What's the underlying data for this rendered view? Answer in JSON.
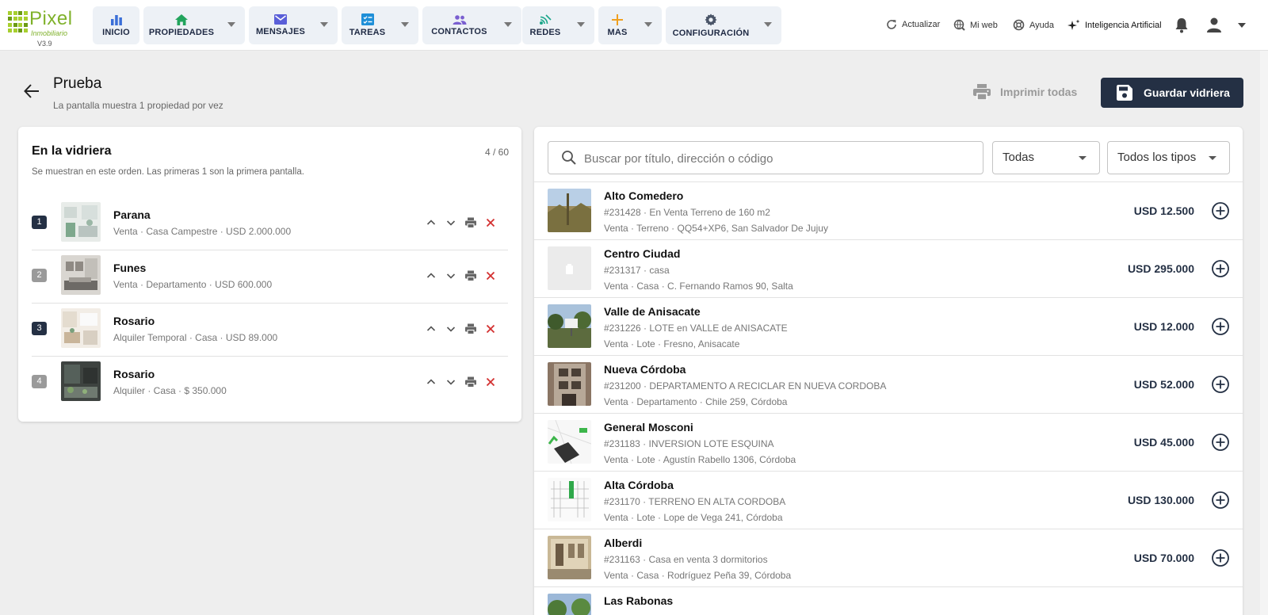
{
  "app": {
    "logo_text": "Pixel",
    "logo_sub": "Inmobiliario",
    "version": "V3.9"
  },
  "nav": {
    "items": [
      {
        "label": "INICIO",
        "icon": "bar-chart-icon",
        "color": "#3b6fd8"
      },
      {
        "label": "PROPIEDADES",
        "icon": "home-icon",
        "color": "#22a45d"
      },
      {
        "label": "MENSAJES",
        "icon": "mail-icon",
        "color": "#5a5fd8"
      },
      {
        "label": "TAREAS",
        "icon": "tasks-icon",
        "color": "#1f8fd8"
      },
      {
        "label": "CONTACTOS",
        "icon": "people-icon",
        "color": "#7a5fd0"
      },
      {
        "label": "REDES",
        "icon": "network-icon",
        "color": "#1aa68a"
      },
      {
        "label": "MAS",
        "icon": "plus-icon",
        "color": "#f0a020"
      },
      {
        "label": "CONFIGURACIÓN",
        "icon": "gear-icon",
        "color": "#4a5568"
      }
    ]
  },
  "tools": {
    "refresh": "Actualizar",
    "web": "Mi web",
    "help": "Ayuda",
    "ai": "Inteligencia Artificial"
  },
  "header": {
    "title": "Prueba",
    "subtitle": "La pantalla muestra 1 propiedad por vez",
    "print_all": "Imprimir todas",
    "save": "Guardar vidriera"
  },
  "showcase": {
    "title": "En la vidriera",
    "count": "4 / 60",
    "subtitle": "Se muestran en este orden. Las primeras 1 son la primera pantalla.",
    "items": [
      {
        "num": "1",
        "name": "Parana",
        "desc": "Venta · Casa Campestre · USD 2.000.000"
      },
      {
        "num": "2",
        "name": "Funes",
        "desc": "Venta · Departamento · USD 600.000"
      },
      {
        "num": "3",
        "name": "Rosario",
        "desc": "Alquiler Temporal · Casa · USD 89.000"
      },
      {
        "num": "4",
        "name": "Rosario",
        "desc": "Alquiler · Casa · $ 350.000"
      }
    ]
  },
  "catalog": {
    "search_placeholder": "Buscar por título, dirección o código",
    "filter_op": "Todas",
    "filter_type": "Todos los tipos",
    "items": [
      {
        "name": "Alto Comedero",
        "line1": "#231428 · En Venta Terreno de 160 m2",
        "line2": "Venta · Terreno · QQ54+XP6, San Salvador De Jujuy",
        "price": "USD 12.500"
      },
      {
        "name": "Centro Ciudad",
        "line1": "#231317 · casa",
        "line2": "Venta · Casa · C. Fernando Ramos 90, Salta",
        "price": "USD 295.000"
      },
      {
        "name": "Valle de Anisacate",
        "line1": "#231226 · LOTE en VALLE de ANISACATE",
        "line2": "Venta · Lote · Fresno, Anisacate",
        "price": "USD 12.000"
      },
      {
        "name": "Nueva Córdoba",
        "line1": "#231200 · DEPARTAMENTO A RECICLAR EN NUEVA CORDOBA",
        "line2": "Venta · Departamento · Chile 259, Córdoba",
        "price": "USD 52.000"
      },
      {
        "name": "General Mosconi",
        "line1": "#231183 · INVERSION LOTE ESQUINA",
        "line2": "Venta · Lote · Agustín Rabello 1306, Córdoba",
        "price": "USD 45.000"
      },
      {
        "name": "Alta Córdoba",
        "line1": "#231170 · TERRENO EN ALTA CORDOBA",
        "line2": "Venta · Lote · Lope de Vega 241, Córdoba",
        "price": "USD 130.000"
      },
      {
        "name": "Alberdi",
        "line1": "#231163 · Casa en venta 3 dormitorios",
        "line2": "Venta · Casa · Rodríguez Peña 39, Córdoba",
        "price": "USD 70.000"
      },
      {
        "name": "Las Rabonas",
        "line1": "",
        "line2": "",
        "price": ""
      }
    ]
  }
}
